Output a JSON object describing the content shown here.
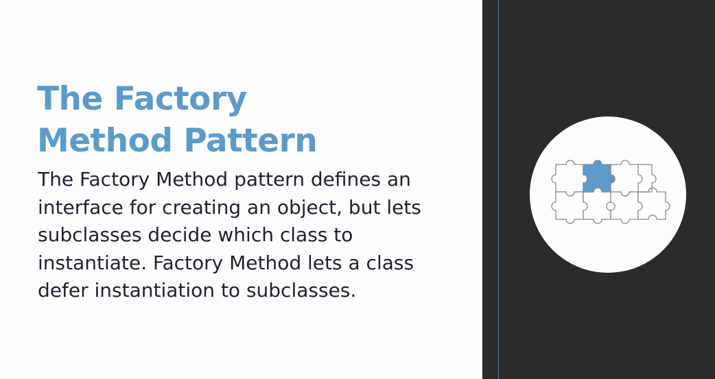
{
  "slide": {
    "title_lines": [
      "The Factory",
      "Method Pattern"
    ],
    "body_lines": [
      "The Factory Method pattern defines an",
      "interface for creating an object, but lets",
      "subclasses decide which class to",
      "instantiate. Factory Method lets a class",
      "defer instantiation to subclasses."
    ]
  },
  "illustration": {
    "icon": "puzzle-pieces-icon",
    "accent_color": "#5b9bc9",
    "outline_color": "#8a8a8a"
  },
  "colors": {
    "title": "#5b9bc9",
    "body": "#1d2130",
    "left_background": "#fdfdfd",
    "right_background": "#2b2b2b",
    "guide_line": "#5a8fbf"
  }
}
